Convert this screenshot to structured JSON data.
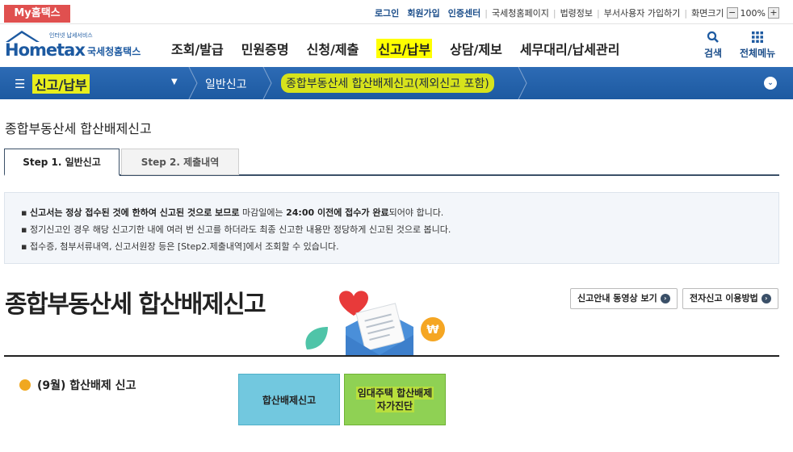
{
  "topbar": {
    "myhome": "My홈택스",
    "links": {
      "login": "로그인",
      "join": "회원가입",
      "cert": "인증센터",
      "nts": "국세청홈페이지",
      "law": "법령정보",
      "dept": "부서사용자 가입하기",
      "screen": "화면크기",
      "zoom": "100%"
    }
  },
  "header": {
    "logo_small": "인터넷 납세서비스",
    "logo_main": "Hometax",
    "logo_sub": "국세청홈택스",
    "nav": [
      "조회/발급",
      "민원증명",
      "신청/제출",
      "신고/납부",
      "상담/제보",
      "세무대리/납세관리"
    ],
    "nav_active_index": 3,
    "search_label": "검색",
    "allmenu_label": "전체메뉴"
  },
  "breadcrumb": {
    "section": "신고/납부",
    "level2": "일반신고",
    "level3": "종합부동산세 합산배제신고(제외신고 포함)"
  },
  "page": {
    "title": "종합부동산세 합산배제신고",
    "tabs": [
      "Step 1. 일반신고",
      "Step 2. 제출내역"
    ],
    "active_tab": 0,
    "notice": {
      "line1_bold": "신고서는 정상 접수된 것에 한하여 신고된 것으로 보므로",
      "line1_mid": " 마감일에는 ",
      "line1_bold2": "24:00 이전에 접수가 완료",
      "line1_end": "되어야 합니다.",
      "line2": "정기신고인 경우 해당 신고기한 내에 여러 번 신고를 하더라도 최종 신고한 내용만 정당하게 신고된 것으로 봅니다.",
      "line3": "접수증, 첨부서류내역, 신고서원장 등은 [Step2.제출내역]에서 조회할 수 있습니다."
    },
    "big_title": "종합부동산세 합산배제신고",
    "guide_video_btn": "신고안내 동영상 보기",
    "howto_btn": "전자신고 이용방법",
    "section_label": "(9월) 합산배제 신고",
    "btn_exclusion": "합산배제신고",
    "btn_selfcheck_line1": "임대주택 합산배제",
    "btn_selfcheck_line2": "자가진단"
  },
  "colors": {
    "brand_blue": "#1d5aa1",
    "highlight_yellow": "#ffff00",
    "myhome_red": "#e0504f",
    "btn_cyan": "#72c8df",
    "btn_green": "#8fd154"
  }
}
